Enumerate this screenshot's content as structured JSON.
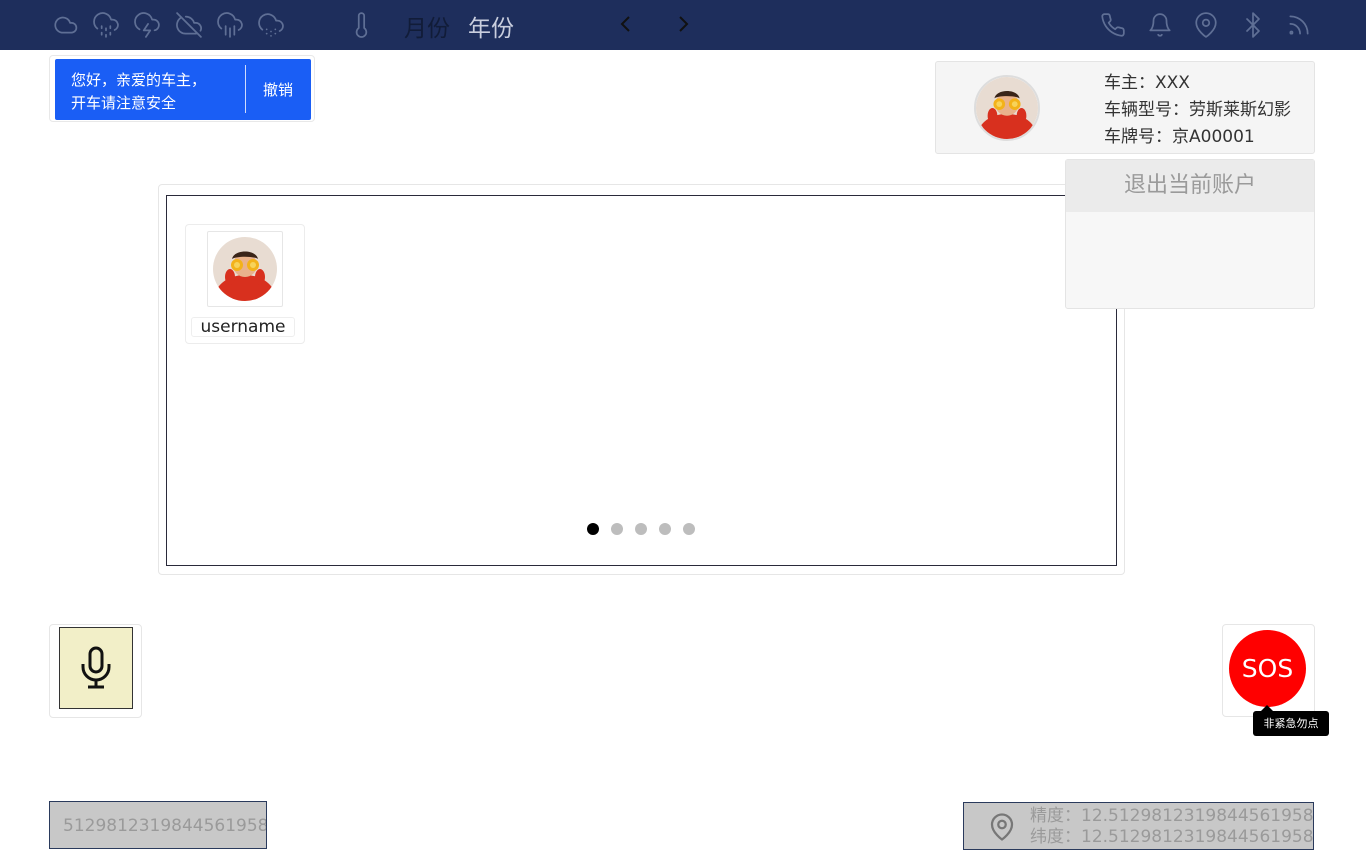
{
  "topbar": {
    "weather_icons": [
      "cloud-icon",
      "cloud-drizzle-icon",
      "cloud-lightning-icon",
      "cloud-off-icon",
      "cloud-rain-icon",
      "cloud-snow-icon"
    ],
    "thermometer_icon": "thermometer-icon",
    "tabs": [
      {
        "label": "月份",
        "active": false
      },
      {
        "label": "年份",
        "active": true
      }
    ],
    "status_icons": [
      "phone-icon",
      "bell-icon",
      "map-pin-icon",
      "bluetooth-icon",
      "rss-icon"
    ]
  },
  "greeting": {
    "line1": "您好，亲爱的车主，",
    "line2": "开车请注意安全",
    "action_label": "撤销"
  },
  "profile": {
    "owner": "车主：XXX",
    "model": "车辆型号：劳斯莱斯幻影",
    "plate": "车牌号：京A00001",
    "menu": {
      "logout_label": "退出当前账户"
    }
  },
  "carousel": {
    "user_card": {
      "username": "username"
    },
    "active_slide": 1,
    "slide_count": 5
  },
  "sos": {
    "label": "SOS",
    "tooltip": "非紧急勿点"
  },
  "bottom": {
    "id_number": "5129812319844561958",
    "longitude": "精度：12.5129812319844561958",
    "latitude": "纬度：12.5129812319844561958"
  },
  "colors": {
    "topbar_bg": "#1e2e5c",
    "greeting_bg": "#1a5ef5",
    "sos_red": "#ff0000",
    "mic_bg": "#f2efc8"
  }
}
